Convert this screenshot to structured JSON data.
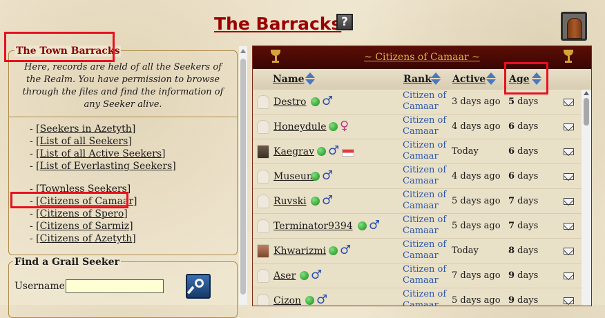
{
  "page": {
    "title": "The Barracks",
    "help_symbol": "?"
  },
  "town_barracks": {
    "legend": "The Town Barracks",
    "intro": "Here, records are held of all the Seekers of the Realm. You have permission to browse through the files and find the information of any Seeker alive.",
    "links_group1": [
      {
        "text": "Seekers in Azetyth"
      },
      {
        "text": "List of all Seekers"
      },
      {
        "text": "List of all Active Seekers"
      },
      {
        "text": "List of Everlasting Seekers"
      }
    ],
    "links_group2": [
      {
        "text": "Townless Seekers"
      },
      {
        "text": "Citizens of Camaar"
      },
      {
        "text": "Citizens of Spero"
      },
      {
        "text": "Citizens of Sarmiz"
      },
      {
        "text": "Citizens of Azetyth"
      }
    ]
  },
  "find_seeker": {
    "legend": "Find a Grail Seeker",
    "username_label": "Username:",
    "username_value": ""
  },
  "citizens": {
    "title": "~ Citizens of Camaar ~",
    "columns": {
      "name": "Name",
      "rank": "Rank",
      "active": "Active",
      "age": "Age"
    },
    "rows": [
      {
        "name": "Destro",
        "avatar": "blank",
        "gender": "male",
        "flag": false,
        "rank": "Citizen of Camaar",
        "active": "3 days ago",
        "age_num": "5",
        "age_unit": " days"
      },
      {
        "name": "Honeydule",
        "avatar": "blank",
        "gender": "female",
        "flag": false,
        "rank": "Citizen of Camaar",
        "active": "4 days ago",
        "age_num": "6",
        "age_unit": " days"
      },
      {
        "name": "Kaegrav",
        "avatar": "photo",
        "gender": "male",
        "flag": true,
        "rank": "Citizen of Camaar",
        "active": "Today",
        "age_num": "6",
        "age_unit": " days"
      },
      {
        "name": "Museum",
        "avatar": "blank",
        "gender": "male",
        "flag": false,
        "rank": "Citizen of Camaar",
        "active": "4 days ago",
        "age_num": "6",
        "age_unit": " days"
      },
      {
        "name": "Ruvski",
        "avatar": "blank",
        "gender": "male",
        "flag": false,
        "rank": "Citizen of Camaar",
        "active": "5 days ago",
        "age_num": "7",
        "age_unit": " days"
      },
      {
        "name": "Terminator9394",
        "avatar": "blank",
        "gender": "male",
        "flag": false,
        "rank": "Citizen of Camaar",
        "active": "5 days ago",
        "age_num": "7",
        "age_unit": " days"
      },
      {
        "name": "Khwarizmi",
        "avatar": "portrait",
        "gender": "male",
        "flag": false,
        "rank": "Citizen of Camaar",
        "active": "Today",
        "age_num": "8",
        "age_unit": " days"
      },
      {
        "name": "Aser",
        "avatar": "blank",
        "gender": "male",
        "flag": false,
        "rank": "Citizen of Camaar",
        "active": "7 days ago",
        "age_num": "9",
        "age_unit": " days"
      },
      {
        "name": "Cizon",
        "avatar": "blank",
        "gender": "male",
        "flag": false,
        "rank": "Citizen of Camaar",
        "active": "5 days ago",
        "age_num": "9",
        "age_unit": " days"
      }
    ]
  },
  "icons": {
    "male": "♂",
    "female": "♀"
  },
  "colors": {
    "title": "#9b0000",
    "header_bg": "#4a0a04",
    "header_text": "#e8b04a",
    "rank_link": "#2b58a8",
    "highlight": "#e8101e",
    "status_online": "#1a8a1a"
  }
}
